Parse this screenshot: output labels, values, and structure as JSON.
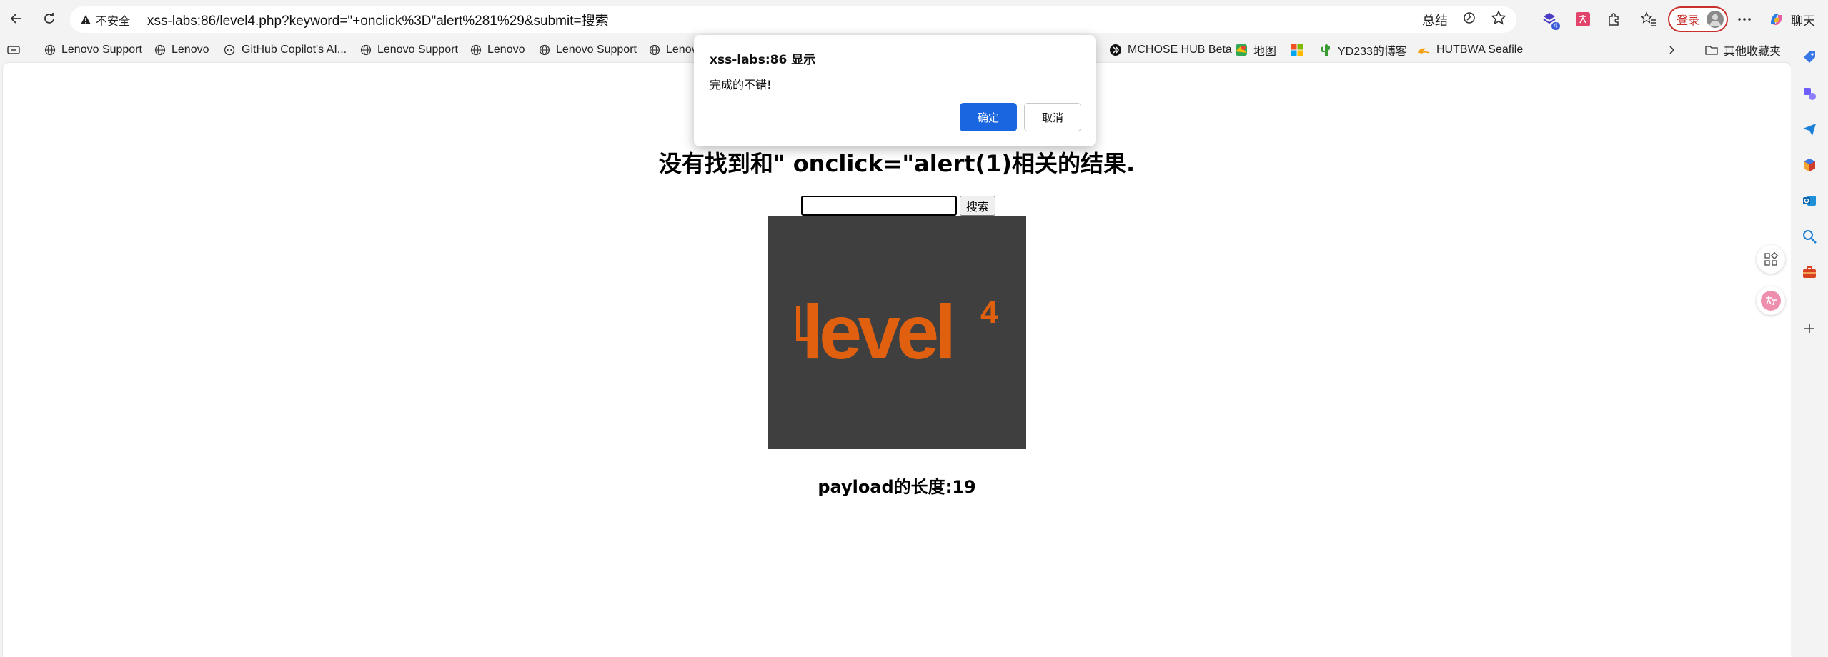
{
  "browser": {
    "address_bar": {
      "security_label": "不安全",
      "url": "xss-labs:86/level4.php?keyword=\"+onclick%3D\"alert%281%29&submit=搜索",
      "summary_label": "总结"
    },
    "extension_badge": "4",
    "login_label": "登录",
    "chat_label": "聊天",
    "accent_color": "#1a66e0",
    "login_color": "#c9302c"
  },
  "bookmarks": [
    {
      "label": "Lenovo Support",
      "icon": "globe-icon"
    },
    {
      "label": "Lenovo",
      "icon": "globe-icon"
    },
    {
      "label": "GitHub Copilot's AI...",
      "icon": "copilot-icon"
    },
    {
      "label": "Lenovo Support",
      "icon": "globe-icon"
    },
    {
      "label": "Lenovo",
      "icon": "globe-icon"
    },
    {
      "label": "Lenovo Support",
      "icon": "globe-icon"
    },
    {
      "label": "Lenov",
      "icon": "globe-icon"
    },
    {
      "label": "MCHOSE HUB Beta",
      "icon": "mchose-icon"
    },
    {
      "label": "地图",
      "icon": "map-icon"
    },
    {
      "label": "",
      "icon": "microsoft-icon"
    },
    {
      "label": "YD233的博客",
      "icon": "cactus-icon"
    },
    {
      "label": "HUTBWA Seafile",
      "icon": "seafile-icon"
    }
  ],
  "other_bookmarks_label": "其他收藏夹",
  "page": {
    "heading": "没有找到和\" onclick=\"alert(1)相关的结果.",
    "search_input_value": "",
    "search_button_label": "搜索",
    "image": {
      "text": "level",
      "superscript": "4",
      "text_color": "#e0600f",
      "bg_color": "#3f3f3f"
    },
    "payload_length": "payload的长度:19"
  },
  "alert": {
    "title": "xss-labs:86 显示",
    "message": "完成的不错!",
    "ok_label": "确定",
    "cancel_label": "取消"
  }
}
